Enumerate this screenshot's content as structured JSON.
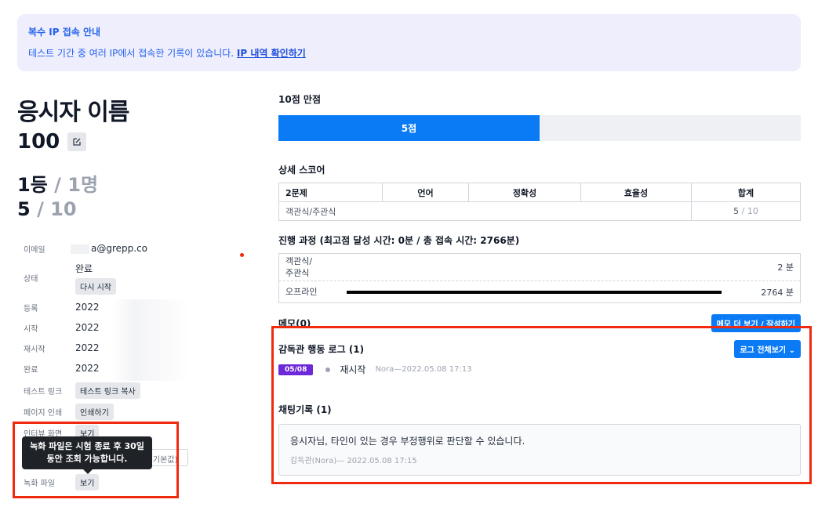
{
  "notice": {
    "title": "복수 IP 접속 안내",
    "body": "테스트 기간 중 여러 IP에서 접속한 기록이 있습니다.",
    "link": "IP 내역 확인하기"
  },
  "candidate": {
    "name": "응시자 이름",
    "score": "100",
    "rank": "1등",
    "rank_total": "/ 1명",
    "points": "5",
    "points_total": "/ 10"
  },
  "info": {
    "email_label": "이메일",
    "email_value": "a@grepp.co",
    "status_label": "상태",
    "status_value": "완료",
    "restart_button": "다시 시작",
    "register_label": "등록",
    "register_value": "2022",
    "start_label": "시작",
    "start_value": "2022",
    "restart_label": "재시작",
    "restart_value": "2022",
    "complete_label": "완료",
    "complete_value": "2022",
    "test_link_label": "테스트 링크",
    "test_link_button": "테스트 링크 복사",
    "print_label": "페이지 인쇄",
    "print_button": "인쇄하기",
    "interview_label": "인터뷰 화면",
    "interview_button": "보기",
    "recording_label": "녹화 파일",
    "recording_button": "보기",
    "tooltip_line1": "녹화 파일은 시험 종료 후 30일",
    "tooltip_line2": "동안 조회 가능합니다.",
    "ghost_button": "(기본값)"
  },
  "score_bar": {
    "title": "10점 만점",
    "label": "5점",
    "fraction": 0.5
  },
  "detail": {
    "title": "상세 스코어",
    "headers": [
      "2문제",
      "언어",
      "정확성",
      "효율성",
      "합계"
    ],
    "row_label": "객관식/주관식",
    "row_total": "5",
    "row_total_max": "/ 10"
  },
  "progress": {
    "title": "진행 과정 (최고점 달성 시간: 0분 / 총 접속 시간: 2766분)",
    "rows": [
      {
        "label": "객관식/\n주관식",
        "value": "2 분"
      },
      {
        "label": "오프라인",
        "value": "2764 분"
      }
    ]
  },
  "memo": {
    "title": "메모(0)",
    "button": "메모 더 보기 / 작성하기"
  },
  "supervisor_log": {
    "title": "감독관 행동 로그 (1)",
    "button": "로그 전체보기 ⌄",
    "date": "05/08",
    "action": "재시작",
    "meta": "Nora—2022.05.08 17:13"
  },
  "chat": {
    "title": "채팅기록 (1)",
    "text": "응시자님, 타인이 있는 경우 부정행위로 판단할 수 있습니다.",
    "meta": "감독관(Nora)— 2022.05.08 17:15"
  }
}
